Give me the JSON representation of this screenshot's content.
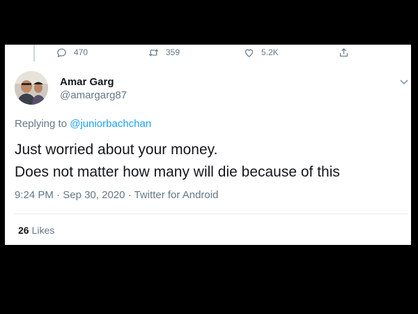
{
  "actions": {
    "reply_count": "470",
    "retweet_count": "359",
    "like_count": "5.2K"
  },
  "tweet": {
    "author_name": "Amar Garg",
    "author_handle": "@amargarg87",
    "replying_prefix": "Replying to",
    "replying_to": "@juniorbachchan",
    "text_line1": "Just worried about your money.",
    "text_line2": "Does not matter how many will die because of this",
    "time": "9:24 PM",
    "date": "Sep 30, 2020",
    "source": "Twitter for Android",
    "likes_count": "26",
    "likes_label": "Likes"
  },
  "colors": {
    "background": "#000000",
    "card": "#ffffff",
    "secondary_text": "#657786",
    "primary_text": "#14171a",
    "link": "#1da1f2"
  },
  "icons": [
    "reply-icon",
    "retweet-icon",
    "like-icon",
    "share-icon",
    "chevron-down-icon"
  ]
}
